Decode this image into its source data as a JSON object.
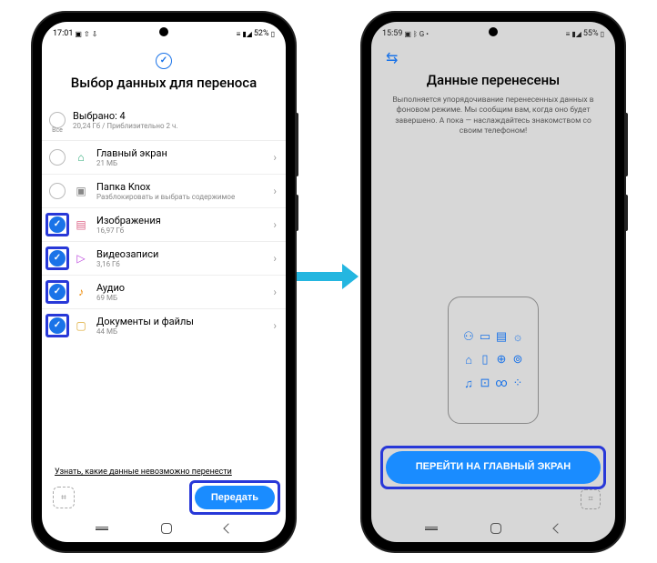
{
  "left": {
    "status": {
      "time": "17:01",
      "battery": "52%"
    },
    "header_title": "Выбор данных для переноса",
    "all_label": "Все",
    "summary": {
      "title": "Выбрано: 4",
      "sub": "20,24 Гб / Приблизительно 2 ч."
    },
    "items": [
      {
        "id": "home",
        "title": "Главный экран",
        "sub": "21 МБ",
        "checked": false,
        "icon": "⌂",
        "icon_class": "ico-home",
        "highlight": false
      },
      {
        "id": "knox",
        "title": "Папка Knox",
        "sub": "Разблокировать и выбрать содержимое",
        "checked": false,
        "icon": "▣",
        "icon_class": "ico-folder",
        "highlight": false
      },
      {
        "id": "images",
        "title": "Изображения",
        "sub": "16,97 Гб",
        "checked": true,
        "icon": "▤",
        "icon_class": "ico-img",
        "highlight": true
      },
      {
        "id": "video",
        "title": "Видеозаписи",
        "sub": "3,16 Гб",
        "checked": true,
        "icon": "▷",
        "icon_class": "ico-vid",
        "highlight": true
      },
      {
        "id": "audio",
        "title": "Аудио",
        "sub": "69 МБ",
        "checked": true,
        "icon": "♪",
        "icon_class": "ico-aud",
        "highlight": true
      },
      {
        "id": "docs",
        "title": "Документы и файлы",
        "sub": "44 МБ",
        "checked": true,
        "icon": "▢",
        "icon_class": "ico-doc",
        "highlight": true
      }
    ],
    "note": "Узнать, какие данные невозможно перенести",
    "send": "Передать"
  },
  "right": {
    "status": {
      "time": "15:59",
      "battery": "55%"
    },
    "title": "Данные перенесены",
    "desc": "Выполняется упорядочивание перенесенных данных в фоновом режиме. Мы сообщим вам, когда оно будет завершено. А пока — наслаждайтесь знакомством со своим телефоном!",
    "grid_icons": [
      "⚇",
      "▭",
      "▤",
      "۞",
      "⌂",
      "▯",
      "⊕",
      "⊚",
      "♫",
      "⊡",
      "∞",
      "⁘"
    ],
    "action": "ПЕРЕЙТИ НА ГЛАВНЫЙ ЭКРАН"
  }
}
